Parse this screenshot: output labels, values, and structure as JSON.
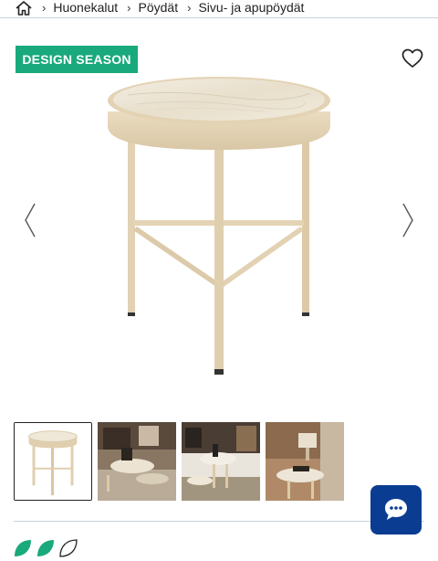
{
  "breadcrumb": {
    "home_icon": "home-icon",
    "items": [
      {
        "label": "Huonekalut"
      },
      {
        "label": "Pöydät"
      },
      {
        "label": "Sivu- ja apupöydät"
      }
    ],
    "separator": "›"
  },
  "product": {
    "badge": "DESIGN SEASON",
    "favorite_icon": "heart-outline-icon",
    "prev_icon": "chevron-left-icon",
    "next_icon": "chevron-right-icon",
    "thumbnail_count": 4,
    "selected_thumbnail": 1
  },
  "chat": {
    "icon": "chat-bubble-icon"
  },
  "rating": {
    "icons": [
      "leaf-filled-icon",
      "leaf-filled-icon",
      "leaf-outline-icon"
    ]
  },
  "colors": {
    "badge_bg": "#19a97c",
    "chat_bg": "#0a3d91",
    "table_frame": "#e6d7bb",
    "marble": "#eee6d6"
  }
}
